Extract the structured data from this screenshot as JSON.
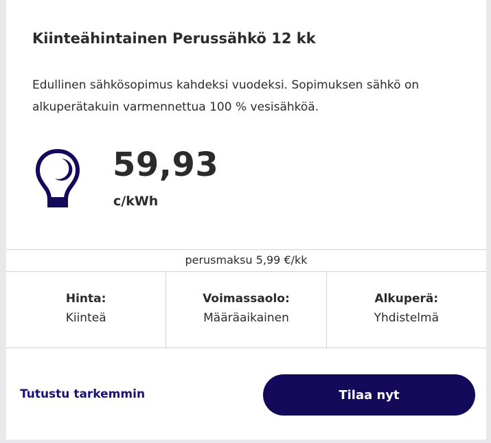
{
  "plan": {
    "title": "Kiinteähintainen Perussähkö 12 kk",
    "description": "Edullinen sähkösopimus kahdeksi vuodeksi. Sopimuksen sähkö on alkuperätakuin varmennettua 100 % vesisähköä.",
    "icon": "lightbulb-icon",
    "price": "59,93",
    "price_unit": "c/kWh",
    "base_fee": "perusmaksu 5,99 €/kk"
  },
  "details": [
    {
      "label": "Hinta:",
      "value": "Kiinteä"
    },
    {
      "label": "Voimassaolo:",
      "value": "Määräaikainen"
    },
    {
      "label": "Alkuperä:",
      "value": "Yhdistelmä"
    }
  ],
  "actions": {
    "learn_more": "Tutustu tarkemmin",
    "order": "Tilaa nyt"
  },
  "colors": {
    "brand": "#140a5a",
    "link": "#1a1078",
    "text": "#2b2b2e",
    "divider": "#d2d2d6",
    "background": "#e9e9ec"
  }
}
